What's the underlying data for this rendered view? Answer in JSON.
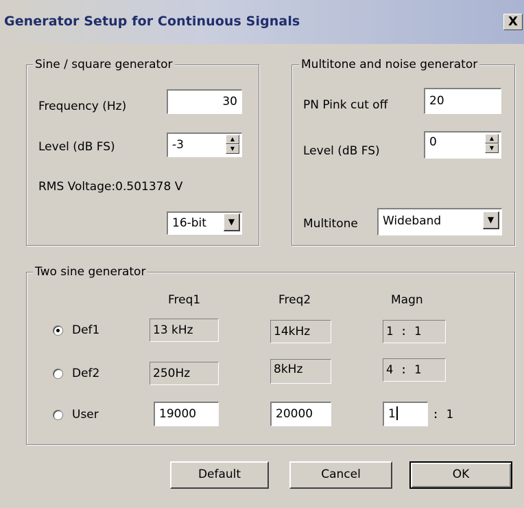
{
  "window": {
    "title": "Generator Setup for Continuous Signals",
    "close_glyph": "X"
  },
  "sine_square": {
    "legend": "Sine / square generator",
    "frequency_label": "Frequency (Hz)",
    "frequency_value": "30",
    "level_label": "Level (dB FS)",
    "level_value": "-3",
    "rms_text": "RMS Voltage:0.501378 V",
    "bitdepth_value": "16-bit"
  },
  "multitone": {
    "legend": "Multitone and noise generator",
    "pn_label": "PN Pink cut off",
    "pn_value": "20",
    "level_label": "Level (dB FS)",
    "level_value": "0",
    "multitone_label": "Multitone",
    "multitone_value": "Wideband"
  },
  "two_sine": {
    "legend": "Two sine generator",
    "col_freq1": "Freq1",
    "col_freq2": "Freq2",
    "col_magn": "Magn",
    "rows": [
      {
        "label": "Def1",
        "freq1": "13 kHz",
        "freq2": "14kHz",
        "magn": "1 : 1",
        "selected": true
      },
      {
        "label": "Def2",
        "freq1": "250Hz",
        "freq2": "8kHz",
        "magn": "4 : 1",
        "selected": false
      },
      {
        "label": "User",
        "freq1": "19000",
        "freq2": "20000",
        "magn": "1",
        "magn_suffix": ": 1",
        "selected": false
      }
    ]
  },
  "buttons": {
    "default": "Default",
    "cancel": "Cancel",
    "ok": "OK"
  },
  "icons": {
    "spin_up": "▲",
    "spin_down": "▼",
    "dropdown": "▼"
  }
}
